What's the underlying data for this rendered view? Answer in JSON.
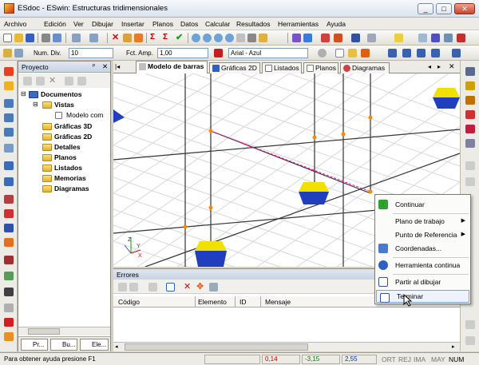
{
  "window": {
    "title": "ESdoc - ESwin: Estructuras tridimensionales",
    "min": "_",
    "max": "□",
    "close": "✕"
  },
  "menu": [
    "Archivo",
    "Edición",
    "Ver",
    "Dibujar",
    "Insertar",
    "Planos",
    "Datos",
    "Calcular",
    "Resultados",
    "Herramientas",
    "Ayuda"
  ],
  "toolbar2": {
    "num_div_label": "Num. Div.",
    "num_div_value": "10",
    "fct_amp_label": "Fct. Amp.",
    "fct_amp_value": "1,00",
    "font_value": "Arial - Azul"
  },
  "project": {
    "title": "Proyecto",
    "pin": "ᵖ",
    "close": "✕",
    "tree": {
      "root": "Documentos",
      "vistas": "Vistas",
      "modelo": "Modelo com",
      "items": [
        "Gráficas 3D",
        "Gráficas 2D",
        "Detalles",
        "Planos",
        "Listados",
        "Memorias",
        "Diagramas"
      ]
    },
    "tabs": [
      "Pr...",
      "Bu...",
      "Ele..."
    ]
  },
  "doc_tabs": [
    "Modelo de barras",
    "Gráficas 2D",
    "Listados",
    "Planos",
    "Diagramas"
  ],
  "viewport": {
    "axis_x": "X",
    "axis_y": "Y",
    "axis_z": "Z"
  },
  "errors": {
    "title": "Errores",
    "columns": [
      "Código",
      "Elemento",
      "ID",
      "Mensaje"
    ]
  },
  "context_menu": {
    "items": [
      "Continuar",
      "Plano de trabajo",
      "Punto de Referencia",
      "Coordenadas...",
      "Herramienta continua",
      "Partir al dibujar",
      "Terminar"
    ]
  },
  "status": {
    "help": "Para obtener ayuda presione F1",
    "x": "0,14",
    "y": "-3,15",
    "z": "2,55",
    "indicators": [
      "ORT",
      "REJ",
      "IMA",
      "MAY",
      "NUM"
    ]
  },
  "colors": {
    "accent": "#316ac5",
    "support": "#1f3fbf",
    "support_top": "#f2e000",
    "node": "#ff8800",
    "dashed": "#ff00aa"
  }
}
